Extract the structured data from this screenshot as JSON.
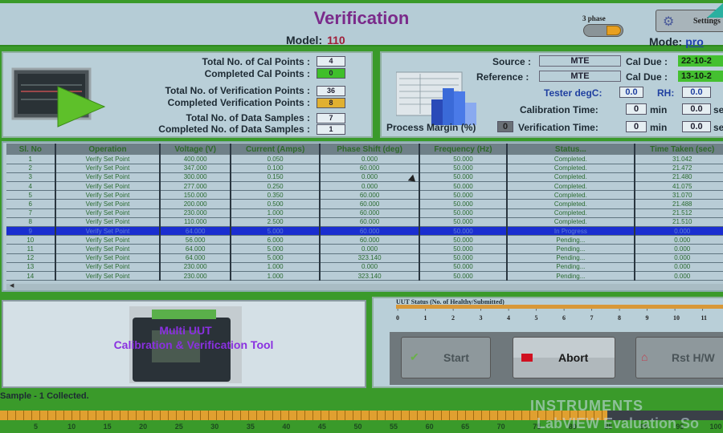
{
  "header": {
    "title": "Verification",
    "model_label": "Model:",
    "model_value": "110",
    "phase_label": "3 phase",
    "phase_toggle_on": true,
    "settings_label": "Settings",
    "settings_icon": "gear-icon",
    "mode_label": "Mode:",
    "mode_value": "pro"
  },
  "cal_stats": {
    "total_cal_points_label": "Total No. of Cal Points",
    "total_cal_points": "4",
    "completed_cal_points_label": "Completed Cal Points",
    "completed_cal_points": "0",
    "total_ver_points_label": "Total No. of Verification Points",
    "total_ver_points": "36",
    "completed_ver_points_label": "Completed Verification Points",
    "completed_ver_points": "8",
    "total_samples_label": "Total No. of Data Samples",
    "total_samples": "7",
    "completed_samples_label": "Completed No. of Data Samples",
    "completed_samples": "1",
    "colors": {
      "completed_cal": "#3fbf2a",
      "completed_ver": "#e0b030"
    }
  },
  "equipment": {
    "source_label": "Source :",
    "source_value": "MTE",
    "source_cal_due_label": "Cal Due :",
    "source_cal_due": "22-10-2",
    "reference_label": "Reference :",
    "reference_value": "MTE",
    "reference_cal_due_label": "Cal Due :",
    "reference_cal_due": "13-10-2",
    "tester_degc_label": "Tester degC:",
    "tester_degc": "0.0",
    "rh_label": "RH:",
    "rh": "0.0",
    "cal_time_label": "Calibration Time:",
    "cal_time_min": "0",
    "cal_time_sec": "0.0",
    "ver_time_label": "Verification Time:",
    "ver_time_min": "0",
    "ver_time_sec": "0.0",
    "min_unit": "min",
    "sec_unit": "se",
    "process_margin_label": "Process Margin (%)",
    "process_margin": "0"
  },
  "table": {
    "columns": [
      "Sl. No",
      "Operation",
      "Voltage (V)",
      "Current (Amps)",
      "Phase Shift (deg)",
      "Frequency (Hz)",
      "Status...",
      "Time Taken (sec)"
    ],
    "selected_row": 8,
    "rows": [
      [
        "1",
        "Verify Set Point",
        "400.000",
        "0.050",
        "0.000",
        "50.000",
        "Completed.",
        "31.042"
      ],
      [
        "2",
        "Verify Set Point",
        "347.000",
        "0.100",
        "60.000",
        "50.000",
        "Completed.",
        "21.472"
      ],
      [
        "3",
        "Verify Set Point",
        "300.000",
        "0.150",
        "0.000",
        "50.000",
        "Completed.",
        "21.480"
      ],
      [
        "4",
        "Verify Set Point",
        "277.000",
        "0.250",
        "0.000",
        "50.000",
        "Completed.",
        "41.075"
      ],
      [
        "5",
        "Verify Set Point",
        "150.000",
        "0.350",
        "60.000",
        "50.000",
        "Completed.",
        "31.070"
      ],
      [
        "6",
        "Verify Set Point",
        "200.000",
        "0.500",
        "60.000",
        "50.000",
        "Completed.",
        "21.488"
      ],
      [
        "7",
        "Verify Set Point",
        "230.000",
        "1.000",
        "60.000",
        "50.000",
        "Completed.",
        "21.512"
      ],
      [
        "8",
        "Verify Set Point",
        "110.000",
        "2.500",
        "60.000",
        "50.000",
        "Completed.",
        "21.510"
      ],
      [
        "9",
        "Verify Set Point",
        "64.000",
        "5.000",
        "60.000",
        "50.000",
        "In Progress",
        "0.000"
      ],
      [
        "10",
        "Verify Set Point",
        "56.000",
        "6.000",
        "60.000",
        "50.000",
        "Pending...",
        "0.000"
      ],
      [
        "11",
        "Verify Set Point",
        "64.000",
        "5.000",
        "0.000",
        "50.000",
        "Pending...",
        "0.000"
      ],
      [
        "12",
        "Verify Set Point",
        "64.000",
        "5.000",
        "323.140",
        "50.000",
        "Pending...",
        "0.000"
      ],
      [
        "13",
        "Verify Set Point",
        "230.000",
        "1.000",
        "0.000",
        "50.000",
        "Pending...",
        "0.000"
      ],
      [
        "14",
        "Verify Set Point",
        "230.000",
        "1.000",
        "323.140",
        "50.000",
        "Pending...",
        "0.000"
      ]
    ]
  },
  "banner": {
    "line1": "Multi UUT",
    "line2": "Calibration & Verification Tool"
  },
  "status_message": "Sample - 1 Collected.",
  "uut_status": {
    "label": "UUT Status (No. of Healthy/Submitted)",
    "ticks": [
      "0",
      "1",
      "2",
      "3",
      "4",
      "5",
      "6",
      "7",
      "8",
      "9",
      "10",
      "11"
    ]
  },
  "controls": {
    "start_label": "Start",
    "abort_label": "Abort",
    "reset_label": "Rst H/W"
  },
  "progress": {
    "percent": 84,
    "ticks": [
      "5",
      "10",
      "15",
      "20",
      "25",
      "30",
      "35",
      "40",
      "45",
      "50",
      "55",
      "60",
      "65",
      "70",
      "75",
      "80",
      "85",
      "90",
      "95",
      "100"
    ]
  },
  "watermark": {
    "line1": "INSTRUMENTS",
    "line2": "LabVIEW Evaluation So"
  }
}
